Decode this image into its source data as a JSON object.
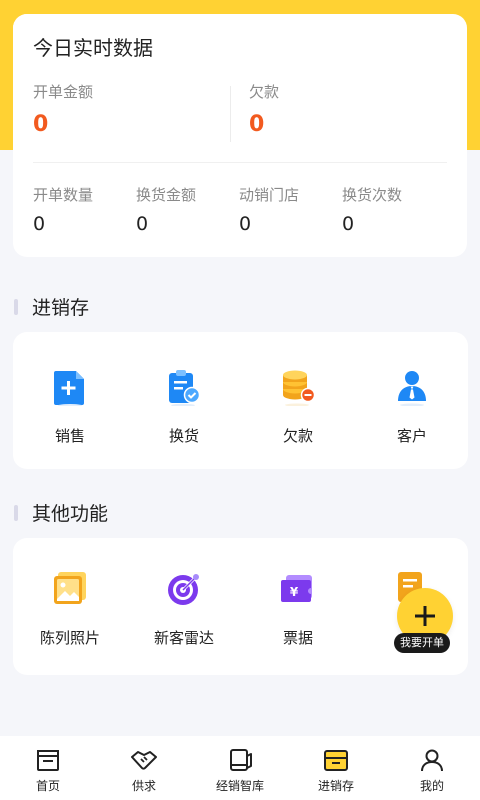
{
  "colors": {
    "brand_yellow": "#FFD233",
    "accent_orange": "#F25A1F",
    "background": "#F5F6FA"
  },
  "stats": {
    "title": "今日实时数据",
    "primary": [
      {
        "label": "开单金额",
        "value": "0"
      },
      {
        "label": "欠款",
        "value": "0"
      }
    ],
    "secondary": [
      {
        "label": "开单数量",
        "value": "0"
      },
      {
        "label": "换货金额",
        "value": "0"
      },
      {
        "label": "动销门店",
        "value": "0"
      },
      {
        "label": "换货次数",
        "value": "0"
      }
    ]
  },
  "jxc": {
    "title": "进销存",
    "items": [
      {
        "label": "销售",
        "icon": "sales-doc-icon"
      },
      {
        "label": "换货",
        "icon": "exchange-clipboard-icon"
      },
      {
        "label": "欠款",
        "icon": "coins-icon"
      },
      {
        "label": "客户",
        "icon": "customer-icon"
      }
    ]
  },
  "other": {
    "title": "其他功能",
    "items": [
      {
        "label": "陈列照片",
        "icon": "photo-icon"
      },
      {
        "label": "新客雷达",
        "icon": "radar-icon"
      },
      {
        "label": "票据",
        "icon": "ticket-icon"
      },
      {
        "label": "",
        "icon": "document-icon"
      }
    ]
  },
  "fab": {
    "label": "我要开单"
  },
  "tabbar": {
    "items": [
      {
        "label": "首页",
        "icon": "home-icon"
      },
      {
        "label": "供求",
        "icon": "handshake-icon"
      },
      {
        "label": "经销智库",
        "icon": "book-icon"
      },
      {
        "label": "进销存",
        "icon": "inventory-box-icon",
        "active": true
      },
      {
        "label": "我的",
        "icon": "user-icon"
      }
    ]
  }
}
